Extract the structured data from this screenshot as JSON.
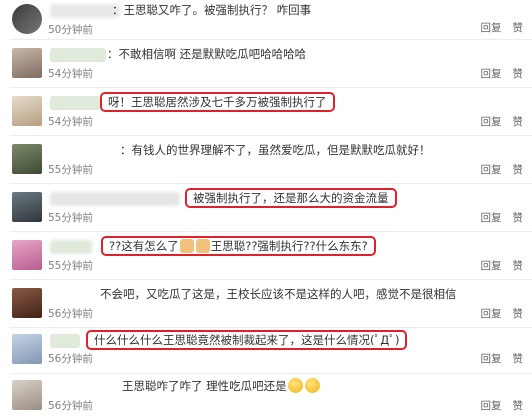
{
  "comments": [
    {
      "user": "",
      "text": "：王思聪又咋了。被强制执行？ 咋回事",
      "time": "50分钟前",
      "reply": "回复",
      "like": "赞"
    },
    {
      "user": "",
      "text": "：不敢相信啊 还是默默吃瓜吧哈哈哈哈",
      "time": "54分钟前",
      "reply": "回复",
      "like": "赞"
    },
    {
      "user": "",
      "text": "呀！王思聪居然涉及七千多万被强制执行了",
      "time": "54分钟前",
      "reply": "回复",
      "like": "赞"
    },
    {
      "user": "",
      "text": "：有钱人的世界理解不了，虽然爱吃瓜，但是默默吃瓜就好！",
      "time": "55分钟前",
      "reply": "回复",
      "like": "赞"
    },
    {
      "user": "",
      "text": "被强制执行了，还是那么大的资金流量",
      "time": "55分钟前",
      "reply": "回复",
      "like": "赞"
    },
    {
      "user": "",
      "text_a": "??这有怎么了",
      "text_b": "王思聪??强制执行??什么东东?",
      "time": "55分钟前",
      "reply": "回复",
      "like": "赞"
    },
    {
      "user": "",
      "text": "不会吧，又吃瓜了这是，王校长应该不是这样的人吧，感觉不是很相信",
      "time": "56分钟前",
      "reply": "回复",
      "like": "赞"
    },
    {
      "user": "",
      "text": "什么什么什么王思聪竟然被制裁起来了，这是什么情况(ﾟДﾟ)",
      "time": "56分钟前",
      "reply": "回复",
      "like": "赞"
    },
    {
      "user": "",
      "text": "王思聪咋了咋了 理性吃瓜吧还是",
      "time": "56分钟前",
      "reply": "回复",
      "like": "赞"
    }
  ],
  "colors": {
    "highlight_border": "#e0202a",
    "time": "#808080",
    "action": "#666666"
  }
}
